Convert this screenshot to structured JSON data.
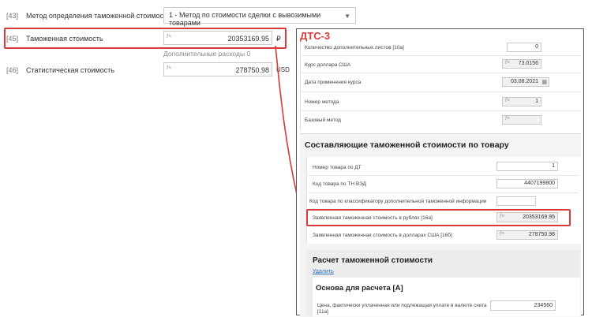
{
  "left": {
    "row43": {
      "num": "[43]",
      "label": "Метод определения таможенной стоимости",
      "select": "1 - Метод по стоимости сделки с вывозимыми товарами"
    },
    "row45": {
      "num": "[45]",
      "label": "Таможенная стоимость",
      "fx": "f×",
      "value": "20353169.95",
      "unit": "₽",
      "note": "Дополнительные расходы 0"
    },
    "row46": {
      "num": "[46]",
      "label": "Статистическая стоимость",
      "fx": "f×",
      "value": "278750.98",
      "unit": "USD"
    }
  },
  "panel": {
    "title": "ДТС-3",
    "top_rows": [
      {
        "label": "Количество дополнительных листов [10а]",
        "value": "0"
      },
      {
        "label": "Курс доллара США",
        "value": "73.0156"
      },
      {
        "label": "Дата применения курса",
        "value": "03.08.2021"
      },
      {
        "label": "Номер метода",
        "value": "1"
      },
      {
        "label": "Базовый метод",
        "value": ""
      }
    ],
    "section1_title": "Составляющие таможенной стоимости по товару",
    "section1_rows": [
      {
        "label": "Номер товара по ДТ",
        "value": "1"
      },
      {
        "label": "Код товара по ТН ВЭД",
        "value": "4407199800"
      },
      {
        "label": "Код товара по классификатору дополнительной таможенной информации",
        "value": ""
      },
      {
        "label": "Заявленная таможенная стоимость в рублях [16а]",
        "value": "20353169.95"
      },
      {
        "label": "Заявленная таможенная стоимость в долларах США [16б]",
        "value": "278750.98"
      }
    ],
    "section2_title": "Расчет таможенной стоимости",
    "delete_link": "Удалить",
    "subsection_title": "Основа для расчета [А]",
    "price_label_1": "Цена, фактически уплаченная или подлежащая уплате в валюте счета",
    "price_label_2": "[11а]",
    "price_value": "234560",
    "fx": "f×"
  },
  "colors": {
    "highlight": "#d63a3a"
  }
}
